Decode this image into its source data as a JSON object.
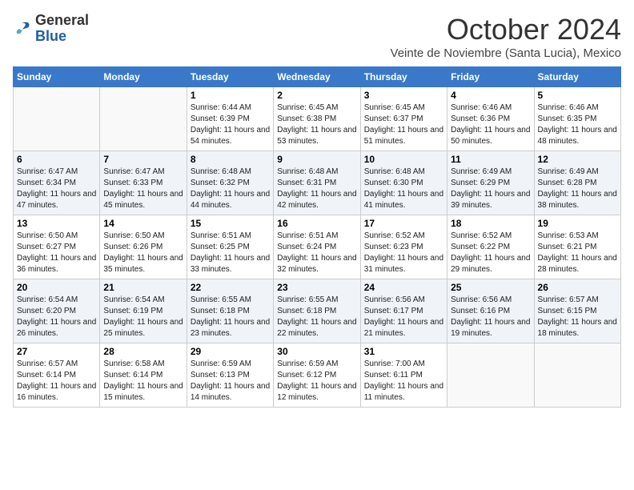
{
  "logo": {
    "general": "General",
    "blue": "Blue"
  },
  "title": "October 2024",
  "location": "Veinte de Noviembre (Santa Lucia), Mexico",
  "days_of_week": [
    "Sunday",
    "Monday",
    "Tuesday",
    "Wednesday",
    "Thursday",
    "Friday",
    "Saturday"
  ],
  "weeks": [
    [
      {
        "day": "",
        "sunrise": "",
        "sunset": "",
        "daylight": ""
      },
      {
        "day": "",
        "sunrise": "",
        "sunset": "",
        "daylight": ""
      },
      {
        "day": "1",
        "sunrise": "Sunrise: 6:44 AM",
        "sunset": "Sunset: 6:39 PM",
        "daylight": "Daylight: 11 hours and 54 minutes."
      },
      {
        "day": "2",
        "sunrise": "Sunrise: 6:45 AM",
        "sunset": "Sunset: 6:38 PM",
        "daylight": "Daylight: 11 hours and 53 minutes."
      },
      {
        "day": "3",
        "sunrise": "Sunrise: 6:45 AM",
        "sunset": "Sunset: 6:37 PM",
        "daylight": "Daylight: 11 hours and 51 minutes."
      },
      {
        "day": "4",
        "sunrise": "Sunrise: 6:46 AM",
        "sunset": "Sunset: 6:36 PM",
        "daylight": "Daylight: 11 hours and 50 minutes."
      },
      {
        "day": "5",
        "sunrise": "Sunrise: 6:46 AM",
        "sunset": "Sunset: 6:35 PM",
        "daylight": "Daylight: 11 hours and 48 minutes."
      }
    ],
    [
      {
        "day": "6",
        "sunrise": "Sunrise: 6:47 AM",
        "sunset": "Sunset: 6:34 PM",
        "daylight": "Daylight: 11 hours and 47 minutes."
      },
      {
        "day": "7",
        "sunrise": "Sunrise: 6:47 AM",
        "sunset": "Sunset: 6:33 PM",
        "daylight": "Daylight: 11 hours and 45 minutes."
      },
      {
        "day": "8",
        "sunrise": "Sunrise: 6:48 AM",
        "sunset": "Sunset: 6:32 PM",
        "daylight": "Daylight: 11 hours and 44 minutes."
      },
      {
        "day": "9",
        "sunrise": "Sunrise: 6:48 AM",
        "sunset": "Sunset: 6:31 PM",
        "daylight": "Daylight: 11 hours and 42 minutes."
      },
      {
        "day": "10",
        "sunrise": "Sunrise: 6:48 AM",
        "sunset": "Sunset: 6:30 PM",
        "daylight": "Daylight: 11 hours and 41 minutes."
      },
      {
        "day": "11",
        "sunrise": "Sunrise: 6:49 AM",
        "sunset": "Sunset: 6:29 PM",
        "daylight": "Daylight: 11 hours and 39 minutes."
      },
      {
        "day": "12",
        "sunrise": "Sunrise: 6:49 AM",
        "sunset": "Sunset: 6:28 PM",
        "daylight": "Daylight: 11 hours and 38 minutes."
      }
    ],
    [
      {
        "day": "13",
        "sunrise": "Sunrise: 6:50 AM",
        "sunset": "Sunset: 6:27 PM",
        "daylight": "Daylight: 11 hours and 36 minutes."
      },
      {
        "day": "14",
        "sunrise": "Sunrise: 6:50 AM",
        "sunset": "Sunset: 6:26 PM",
        "daylight": "Daylight: 11 hours and 35 minutes."
      },
      {
        "day": "15",
        "sunrise": "Sunrise: 6:51 AM",
        "sunset": "Sunset: 6:25 PM",
        "daylight": "Daylight: 11 hours and 33 minutes."
      },
      {
        "day": "16",
        "sunrise": "Sunrise: 6:51 AM",
        "sunset": "Sunset: 6:24 PM",
        "daylight": "Daylight: 11 hours and 32 minutes."
      },
      {
        "day": "17",
        "sunrise": "Sunrise: 6:52 AM",
        "sunset": "Sunset: 6:23 PM",
        "daylight": "Daylight: 11 hours and 31 minutes."
      },
      {
        "day": "18",
        "sunrise": "Sunrise: 6:52 AM",
        "sunset": "Sunset: 6:22 PM",
        "daylight": "Daylight: 11 hours and 29 minutes."
      },
      {
        "day": "19",
        "sunrise": "Sunrise: 6:53 AM",
        "sunset": "Sunset: 6:21 PM",
        "daylight": "Daylight: 11 hours and 28 minutes."
      }
    ],
    [
      {
        "day": "20",
        "sunrise": "Sunrise: 6:54 AM",
        "sunset": "Sunset: 6:20 PM",
        "daylight": "Daylight: 11 hours and 26 minutes."
      },
      {
        "day": "21",
        "sunrise": "Sunrise: 6:54 AM",
        "sunset": "Sunset: 6:19 PM",
        "daylight": "Daylight: 11 hours and 25 minutes."
      },
      {
        "day": "22",
        "sunrise": "Sunrise: 6:55 AM",
        "sunset": "Sunset: 6:18 PM",
        "daylight": "Daylight: 11 hours and 23 minutes."
      },
      {
        "day": "23",
        "sunrise": "Sunrise: 6:55 AM",
        "sunset": "Sunset: 6:18 PM",
        "daylight": "Daylight: 11 hours and 22 minutes."
      },
      {
        "day": "24",
        "sunrise": "Sunrise: 6:56 AM",
        "sunset": "Sunset: 6:17 PM",
        "daylight": "Daylight: 11 hours and 21 minutes."
      },
      {
        "day": "25",
        "sunrise": "Sunrise: 6:56 AM",
        "sunset": "Sunset: 6:16 PM",
        "daylight": "Daylight: 11 hours and 19 minutes."
      },
      {
        "day": "26",
        "sunrise": "Sunrise: 6:57 AM",
        "sunset": "Sunset: 6:15 PM",
        "daylight": "Daylight: 11 hours and 18 minutes."
      }
    ],
    [
      {
        "day": "27",
        "sunrise": "Sunrise: 6:57 AM",
        "sunset": "Sunset: 6:14 PM",
        "daylight": "Daylight: 11 hours and 16 minutes."
      },
      {
        "day": "28",
        "sunrise": "Sunrise: 6:58 AM",
        "sunset": "Sunset: 6:14 PM",
        "daylight": "Daylight: 11 hours and 15 minutes."
      },
      {
        "day": "29",
        "sunrise": "Sunrise: 6:59 AM",
        "sunset": "Sunset: 6:13 PM",
        "daylight": "Daylight: 11 hours and 14 minutes."
      },
      {
        "day": "30",
        "sunrise": "Sunrise: 6:59 AM",
        "sunset": "Sunset: 6:12 PM",
        "daylight": "Daylight: 11 hours and 12 minutes."
      },
      {
        "day": "31",
        "sunrise": "Sunrise: 7:00 AM",
        "sunset": "Sunset: 6:11 PM",
        "daylight": "Daylight: 11 hours and 11 minutes."
      },
      {
        "day": "",
        "sunrise": "",
        "sunset": "",
        "daylight": ""
      },
      {
        "day": "",
        "sunrise": "",
        "sunset": "",
        "daylight": ""
      }
    ]
  ]
}
